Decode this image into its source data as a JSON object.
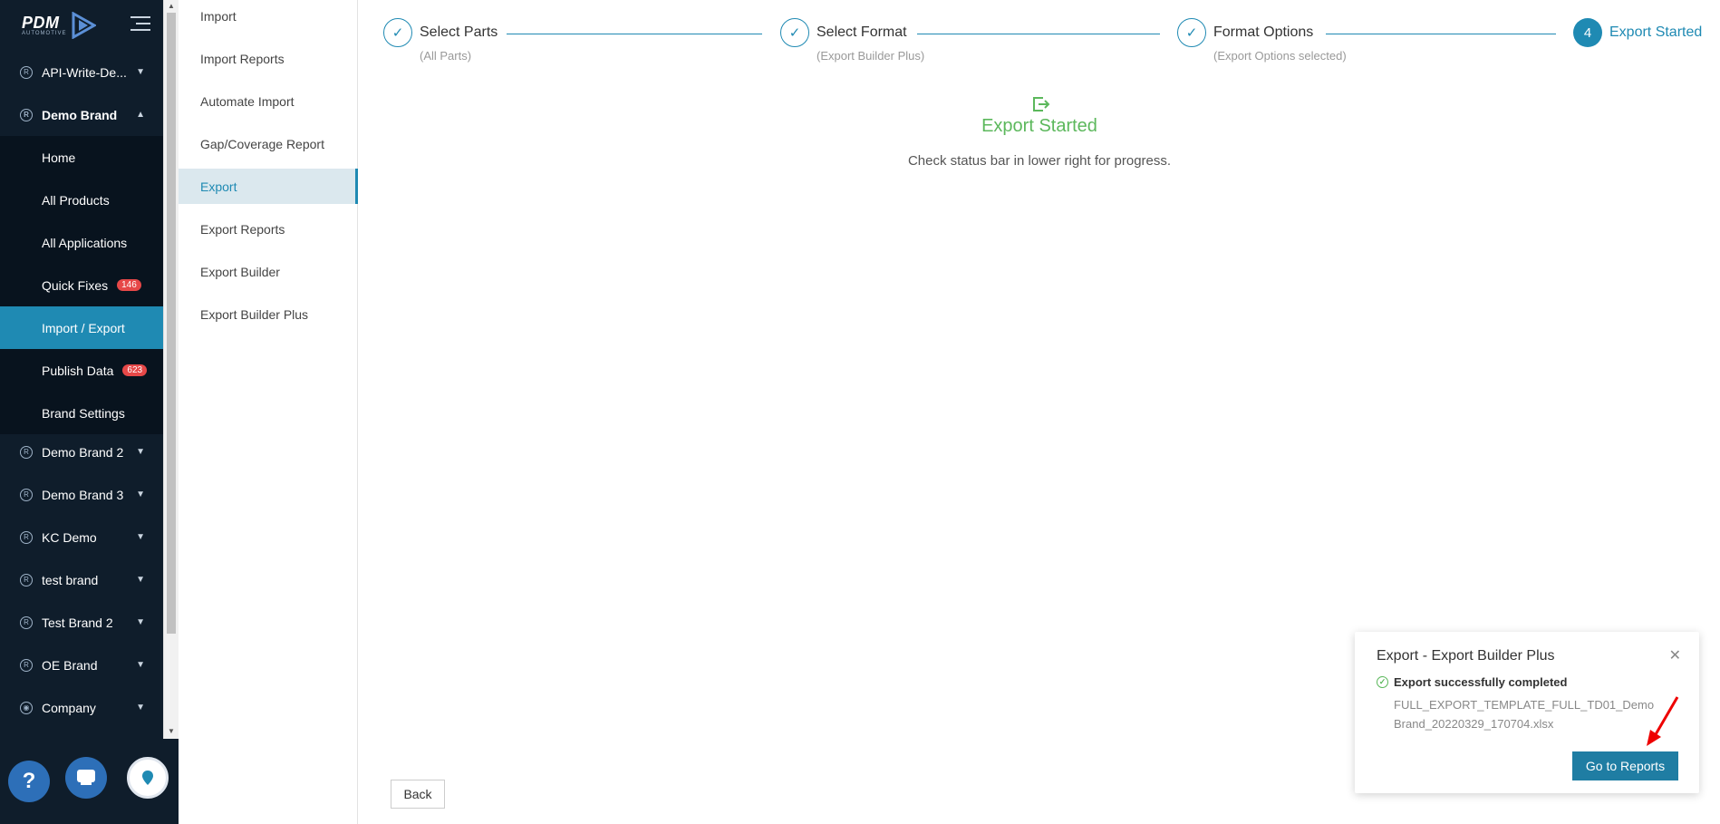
{
  "brand": {
    "name": "PDM",
    "tagline": "AUTOMOTIVE"
  },
  "sidebar": {
    "items": [
      {
        "label": "API-Write-De...",
        "kind": "brand"
      },
      {
        "label": "Demo Brand",
        "kind": "brand",
        "open": true
      },
      {
        "label": "Home",
        "kind": "sub"
      },
      {
        "label": "All Products",
        "kind": "sub"
      },
      {
        "label": "All Applications",
        "kind": "sub"
      },
      {
        "label": "Quick Fixes",
        "kind": "sub",
        "badge": "146"
      },
      {
        "label": "Import / Export",
        "kind": "sub",
        "active": true
      },
      {
        "label": "Publish Data",
        "kind": "sub",
        "badge": "623"
      },
      {
        "label": "Brand Settings",
        "kind": "sub"
      },
      {
        "label": "Demo Brand 2",
        "kind": "brand"
      },
      {
        "label": "Demo Brand 3",
        "kind": "brand"
      },
      {
        "label": "KC Demo",
        "kind": "brand"
      },
      {
        "label": "test brand",
        "kind": "brand"
      },
      {
        "label": "Test Brand 2",
        "kind": "brand"
      },
      {
        "label": "OE Brand",
        "kind": "brand"
      },
      {
        "label": "Company",
        "kind": "company"
      }
    ]
  },
  "submenu": {
    "items": [
      {
        "label": "Import"
      },
      {
        "label": "Import Reports"
      },
      {
        "label": "Automate Import"
      },
      {
        "label": "Gap/Coverage Report"
      },
      {
        "label": "Export",
        "active": true
      },
      {
        "label": "Export Reports"
      },
      {
        "label": "Export Builder"
      },
      {
        "label": "Export Builder Plus"
      }
    ]
  },
  "steps": [
    {
      "title": "Select Parts",
      "desc": "(All Parts)",
      "state": "done"
    },
    {
      "title": "Select Format",
      "desc": "(Export Builder Plus)",
      "state": "done"
    },
    {
      "title": "Format Options",
      "desc": "(Export Options selected)",
      "state": "done"
    },
    {
      "title": "Export Started",
      "number": "4",
      "state": "current"
    }
  ],
  "main": {
    "title": "Export Started",
    "description": "Check status bar in lower right for progress.",
    "back_label": "Back"
  },
  "notification": {
    "title": "Export - Export Builder Plus",
    "status": "Export successfully completed",
    "file_line1": "FULL_EXPORT_TEMPLATE_FULL_TD01_Demo",
    "file_line2": "Brand_20220329_170704.xlsx",
    "button_label": "Go to Reports"
  },
  "colors": {
    "accent": "#1f8ab3",
    "success": "#5cb85c",
    "badge": "#e64848",
    "sidebar": "#0f1d2b"
  }
}
